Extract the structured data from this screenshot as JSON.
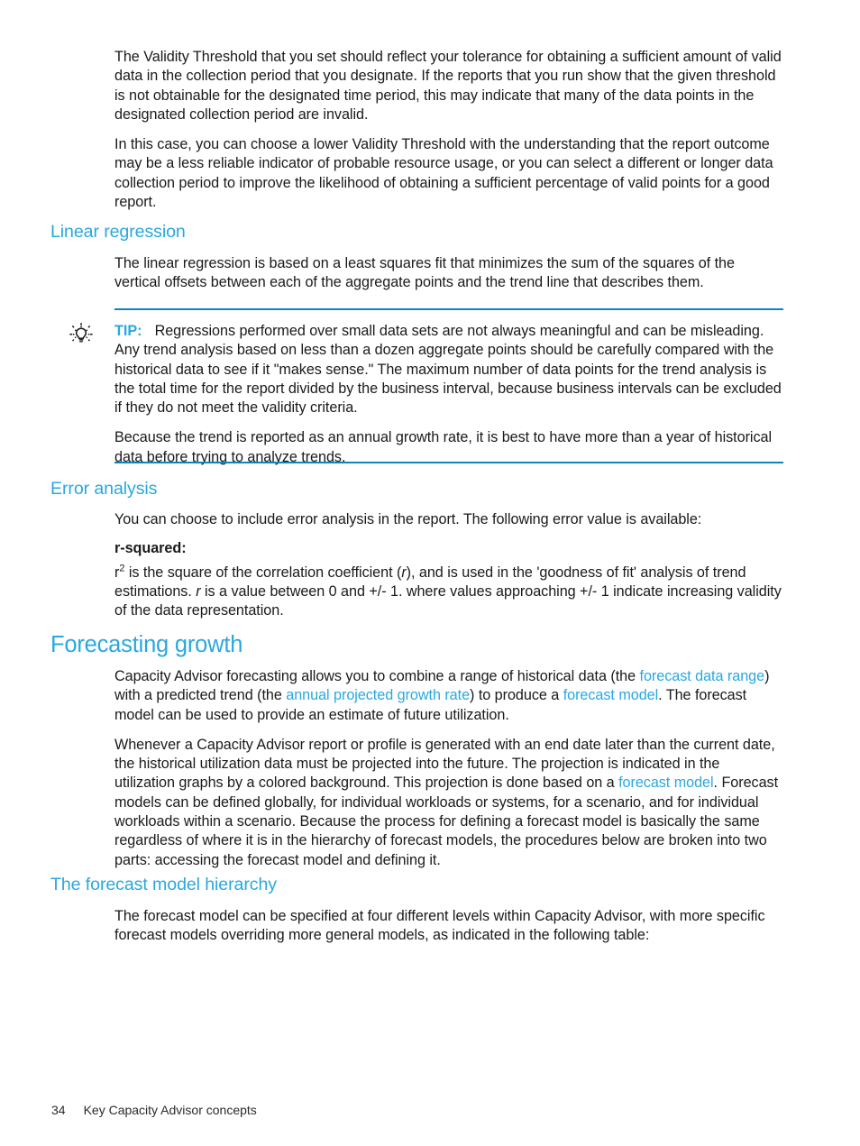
{
  "document": {
    "page_number": "34",
    "footer_title": "Key Capacity Advisor concepts"
  },
  "intro": {
    "paragraph_1": "The Validity Threshold that you set should reflect your tolerance for obtaining a sufficient amount of valid data in the collection period that you designate. If the reports that you run show that the given threshold is not obtainable for the designated time period, this may indicate that many of the data points in the designated collection period are invalid.",
    "paragraph_2": "In this case, you can choose a lower Validity Threshold with the understanding that the report outcome may be a less reliable indicator of probable resource usage, or you can select a different or longer data collection period to improve the likelihood of obtaining a sufficient percentage of valid points for a good report."
  },
  "linear_regression": {
    "heading": "Linear regression",
    "paragraph": "The linear regression is based on a least squares fit that minimizes the sum of the squares of the vertical offsets between each of the aggregate points and the trend line that describes them.",
    "tip": {
      "label": "TIP:",
      "icon": "lightbulb-icon",
      "paragraph_1": "Regressions performed over small data sets are not always meaningful and can be misleading. Any trend analysis based on less than a dozen aggregate points should be carefully compared with the historical data to see if it \"makes sense.\" The maximum number of data points for the trend analysis is the total time for the report divided by the business interval, because business intervals can be excluded if they do not meet the validity criteria.",
      "paragraph_2": "Because the trend is reported as an annual growth rate, it is best to have more than a year of historical data before trying to analyze trends."
    }
  },
  "error_analysis": {
    "heading": "Error analysis",
    "paragraph": "You can choose to include error analysis in the report. The following error value is available:",
    "term": "r-squared:",
    "definition_part_1": "r",
    "definition_superscript": "2",
    "definition_part_2": " is the square of the correlation coefficient (",
    "definition_italic_r_1": "r",
    "definition_part_3": "), and is used in the 'goodness of fit' analysis of trend estimations. ",
    "definition_italic_r_2": "r",
    "definition_part_4": " is a value between 0 and +/- 1. where values approaching +/- 1 indicate increasing validity of the data representation."
  },
  "forecasting_growth": {
    "heading": "Forecasting growth",
    "paragraph_1": {
      "text_1": "Capacity Advisor forecasting allows you to combine a range of historical data (the ",
      "link_1": "forecast data range",
      "text_2": ") with a predicted trend (the ",
      "link_2": "annual projected growth rate",
      "text_3": ") to produce a ",
      "link_3": "forecast model",
      "text_4": ". The forecast model can be used to provide an estimate of future utilization."
    },
    "paragraph_2": {
      "text_1": "Whenever a Capacity Advisor report or profile is generated with an end date later than the current date, the historical utilization data must be projected into the future. The projection is indicated in the utilization graphs by a colored background. This projection is done based on a ",
      "link_1": "forecast model",
      "text_2": ". Forecast models can be defined globally, for individual workloads or systems, for a scenario, and for individual workloads within a scenario. Because the process for defining a forecast model is basically the same regardless of where it is in the hierarchy of forecast models, the procedures below are broken into two parts: accessing the forecast model and defining it."
    }
  },
  "forecast_model_hierarchy": {
    "heading": "The forecast model hierarchy",
    "paragraph": "The forecast model can be specified at four different levels within Capacity Advisor, with more specific forecast models overriding more general models, as indicated in the following table:"
  },
  "colors": {
    "heading_blue": "#29a8df",
    "link_blue": "#29a8df",
    "rule_blue": "#1183bb",
    "body_text": "#1a1a1a"
  }
}
